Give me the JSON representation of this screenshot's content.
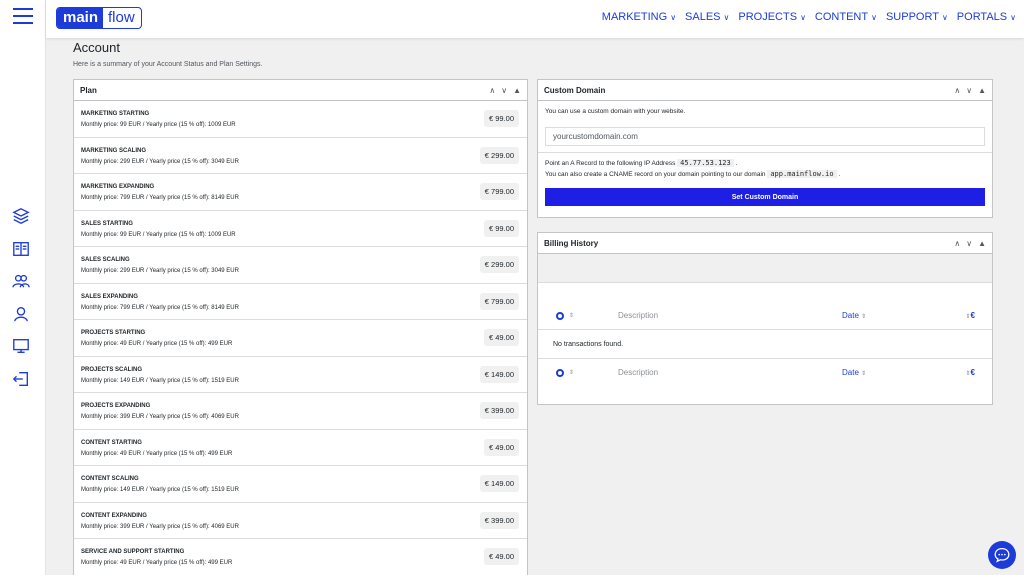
{
  "brand": {
    "part_a": "main",
    "part_b": "flow"
  },
  "nav": [
    {
      "label": "MARKETING",
      "name": "nav-marketing"
    },
    {
      "label": "SALES",
      "name": "nav-sales"
    },
    {
      "label": "PROJECTS",
      "name": "nav-projects"
    },
    {
      "label": "CONTENT",
      "name": "nav-content"
    },
    {
      "label": "SUPPORT",
      "name": "nav-support"
    },
    {
      "label": "PORTALS",
      "name": "nav-portals"
    }
  ],
  "page": {
    "title": "Account",
    "subtitle": "Here is a summary of your Account Status and Plan Settings."
  },
  "plan": {
    "title": "Plan",
    "rows": [
      {
        "name": "MARKETING STARTING",
        "desc": "Monthly price: 99 EUR / Yearly price (15 % off): 1009 EUR",
        "price": "€ 99.00"
      },
      {
        "name": "MARKETING SCALING",
        "desc": "Monthly price: 299 EUR / Yearly price (15 % off): 3049 EUR",
        "price": "€ 299.00"
      },
      {
        "name": "MARKETING EXPANDING",
        "desc": "Monthly price: 799 EUR / Yearly price (15 % off): 8149 EUR",
        "price": "€ 799.00"
      },
      {
        "name": "SALES STARTING",
        "desc": "Monthly price: 99 EUR / Yearly price (15 % off): 1009 EUR",
        "price": "€ 99.00"
      },
      {
        "name": "SALES SCALING",
        "desc": "Monthly price: 299 EUR / Yearly price (15 % off): 3049 EUR",
        "price": "€ 299.00"
      },
      {
        "name": "SALES EXPANDING",
        "desc": "Monthly price: 799 EUR / Yearly price (15 % off): 8149 EUR",
        "price": "€ 799.00"
      },
      {
        "name": "PROJECTS STARTING",
        "desc": "Monthly price: 49 EUR / Yearly price (15 % off): 499 EUR",
        "price": "€ 49.00"
      },
      {
        "name": "PROJECTS SCALING",
        "desc": "Monthly price: 149 EUR / Yearly price (15 % off): 1519 EUR",
        "price": "€ 149.00"
      },
      {
        "name": "PROJECTS EXPANDING",
        "desc": "Monthly price: 399 EUR / Yearly price (15 % off): 4069 EUR",
        "price": "€ 399.00"
      },
      {
        "name": "CONTENT STARTING",
        "desc": "Monthly price: 49 EUR / Yearly price (15 % off): 499 EUR",
        "price": "€ 49.00"
      },
      {
        "name": "CONTENT SCALING",
        "desc": "Monthly price: 149 EUR / Yearly price (15 % off): 1519 EUR",
        "price": "€ 149.00"
      },
      {
        "name": "CONTENT EXPANDING",
        "desc": "Monthly price: 399 EUR / Yearly price (15 % off): 4069 EUR",
        "price": "€ 399.00"
      },
      {
        "name": "SERVICE AND SUPPORT STARTING",
        "desc": "Monthly price: 49 EUR / Yearly price (15 % off): 499 EUR",
        "price": "€ 49.00"
      }
    ]
  },
  "domain": {
    "title": "Custom Domain",
    "intro": "You can use a custom domain with your website.",
    "placeholder": "yourcustomdomain.com",
    "a_record_text": "Point an A Record to the following IP Address",
    "ip": "45.77.53.123",
    "cname_text": "You can also create a CNAME record on your domain pointing to our domain",
    "cname_target": "app.mainflow.io",
    "button": "Set Custom Domain"
  },
  "billing": {
    "title": "Billing History",
    "col_description": "Description",
    "col_date": "Date",
    "col_amount": "€",
    "empty": "No transactions found."
  },
  "colors": {
    "accent": "#1d3bd8",
    "button": "#1d1fe4"
  }
}
